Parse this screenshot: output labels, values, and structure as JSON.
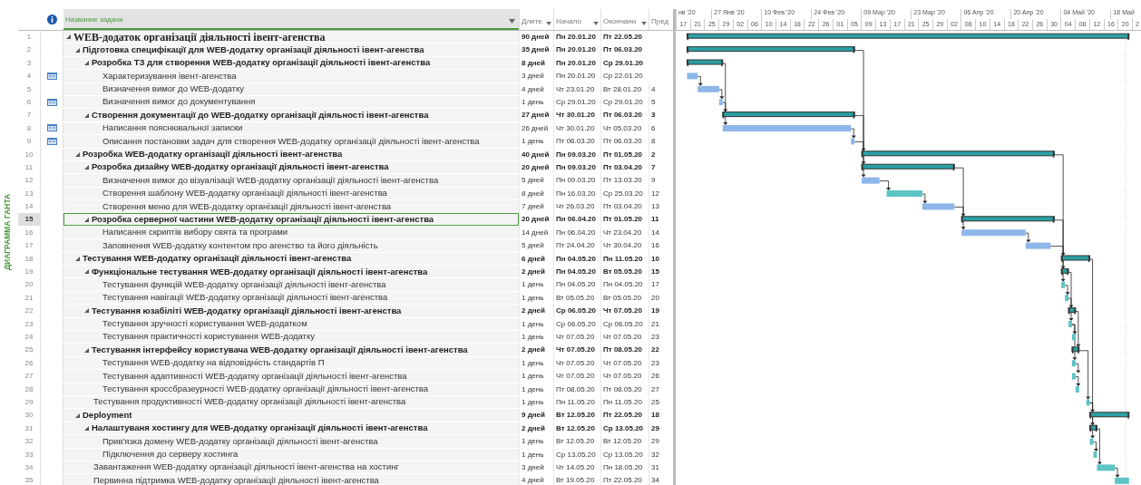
{
  "sidebar_label": "ДИАГРАММА ГАНТА",
  "columns": {
    "name": "Название задачи",
    "duration": "Длите",
    "start": "Начало",
    "finish": "Окончани",
    "predecessors": "Пред"
  },
  "timeline": {
    "weeks": [
      "нв '20",
      "27 Янв '20",
      "10 Фев '20",
      "24 Фев '20",
      "09 Мар '20",
      "23 Мар '20",
      "06 Апр '20",
      "20 Апр '20",
      "04 Май '20",
      "18 Май"
    ],
    "days": [
      "17",
      "21",
      "25",
      "29",
      "02",
      "06",
      "10",
      "14",
      "18",
      "22",
      "26",
      "01",
      "05",
      "09",
      "13",
      "17",
      "21",
      "25",
      "29",
      "02",
      "06",
      "10",
      "14",
      "18",
      "22",
      "26",
      "30",
      "04",
      "08",
      "12",
      "16",
      "20",
      "2"
    ]
  },
  "tasks": [
    {
      "id": "1",
      "kind": "summary",
      "expanded": true,
      "note": false,
      "selected": false,
      "name": "WEB-додаток організації діяльності івент-агенства",
      "duration": "90 дней",
      "start": "Пн 20.01.20",
      "finish": "Пт 22.05.20",
      "children": [
        {
          "id": "2",
          "kind": "summary",
          "expanded": true,
          "note": false,
          "selected": false,
          "name": "Підготовка специфікації для WEB-додатку організації діяльності івент-агенства",
          "duration": "35 дней",
          "start": "Пн 20.01.20",
          "finish": "Пт 06.03.20",
          "children": [
            {
              "id": "3",
              "kind": "summary",
              "expanded": true,
              "note": false,
              "selected": false,
              "name": "Розробка ТЗ для створення WEB-додатку організації діяльності івент-агенства",
              "duration": "8 дней",
              "start": "Пн 20.01.20",
              "finish": "Ср 29.01.20",
              "children": [
                {
                  "id": "4",
                  "kind": "task",
                  "critical": false,
                  "note": true,
                  "selected": false,
                  "name": "Характеризування івент-агенства",
                  "duration": "3 дней",
                  "start": "Пн 20.01.20",
                  "finish": "Ср 22.01.20"
                },
                {
                  "id": "5",
                  "kind": "task",
                  "critical": false,
                  "note": false,
                  "selected": false,
                  "name": "Визначення вимог до WEB-додатку",
                  "duration": "4 дней",
                  "start": "Чт 23.01.20",
                  "finish": "Вт 28.01.20",
                  "predecessors": "4"
                },
                {
                  "id": "6",
                  "kind": "task",
                  "critical": false,
                  "note": true,
                  "selected": false,
                  "name": "Визначення вимог до документування",
                  "duration": "1 день",
                  "start": "Ср 29.01.20",
                  "finish": "Ср 29.01.20",
                  "predecessors": "5"
                }
              ]
            },
            {
              "id": "7",
              "kind": "summary",
              "expanded": true,
              "note": false,
              "selected": false,
              "name": "Створення документації до WEB-додатку організації діяльності івент-агенства",
              "duration": "27 дней",
              "start": "Чт 30.01.20",
              "finish": "Пт 06.03.20",
              "predecessors": "3",
              "children": [
                {
                  "id": "8",
                  "kind": "task",
                  "critical": false,
                  "note": true,
                  "selected": false,
                  "name": "Написання пояснювальної записки",
                  "duration": "26 дней",
                  "start": "Чт 30.01.20",
                  "finish": "Чт 05.03.20",
                  "predecessors": "6"
                },
                {
                  "id": "9",
                  "kind": "task",
                  "critical": false,
                  "note": true,
                  "selected": false,
                  "name": "Описання постановки задач для створення WEB-додатку організації діяльності івент-агенства",
                  "duration": "1 день",
                  "start": "Пт 06.03.20",
                  "finish": "Пт 06.03.20",
                  "predecessors": "8"
                }
              ]
            }
          ]
        },
        {
          "id": "10",
          "kind": "summary",
          "expanded": true,
          "note": false,
          "selected": false,
          "name": "Розробка WEB-додатку організації діяльності івент-агенства",
          "duration": "40 дней",
          "start": "Пн 09.03.20",
          "finish": "Пт 01.05.20",
          "predecessors": "2",
          "children": [
            {
              "id": "11",
              "kind": "summary",
              "expanded": true,
              "note": false,
              "selected": false,
              "name": "Розробка дизайну  WEB-додатку організації діяльності івент-агенства",
              "duration": "20 дней",
              "start": "Пн 09.03.20",
              "finish": "Пт 03.04.20",
              "predecessors": "7",
              "children": [
                {
                  "id": "12",
                  "kind": "task",
                  "critical": false,
                  "note": false,
                  "selected": false,
                  "name": "Визначення вимог до візуалізації WEB-додатку організації діяльності івент-агенства",
                  "duration": "5 дней",
                  "start": "Пн 09.03.20",
                  "finish": "Пт 13.03.20",
                  "predecessors": "9"
                },
                {
                  "id": "13",
                  "kind": "task",
                  "critical": true,
                  "note": false,
                  "selected": false,
                  "name": "Створення шаблону WEB-додатку організації діяльності івент-агенства",
                  "duration": "8 дней",
                  "start": "Пн 16.03.20",
                  "finish": "Ср 25.03.20",
                  "predecessors": "12"
                },
                {
                  "id": "14",
                  "kind": "task",
                  "critical": false,
                  "note": false,
                  "selected": false,
                  "name": "Створення меню для WEB-додатку організації діяльності івент-агенства",
                  "duration": "7 дней",
                  "start": "Чт 26.03.20",
                  "finish": "Пт 03.04.20",
                  "predecessors": "13"
                }
              ]
            },
            {
              "id": "15",
              "kind": "summary",
              "expanded": true,
              "note": false,
              "selected": true,
              "name": "Розробка серверної частини WEB-додатку організації діяльності івент-агенства",
              "duration": "20 дней",
              "start": "Пн 06.04.20",
              "finish": "Пт 01.05.20",
              "predecessors": "11",
              "children": [
                {
                  "id": "16",
                  "kind": "task",
                  "critical": false,
                  "note": false,
                  "selected": false,
                  "name": "Написання скриптів вибору свята та програми",
                  "duration": "14 дней",
                  "start": "Пн 06.04.20",
                  "finish": "Чт 23.04.20",
                  "predecessors": "14"
                },
                {
                  "id": "17",
                  "kind": "task",
                  "critical": false,
                  "note": false,
                  "selected": false,
                  "name": "Заповнення WEB-додатку контентом про агенство та його діяльність",
                  "duration": "5 дней",
                  "start": "Пт 24.04.20",
                  "finish": "Чт 30.04.20",
                  "predecessors": "16"
                }
              ]
            }
          ]
        },
        {
          "id": "18",
          "kind": "summary",
          "expanded": true,
          "note": false,
          "selected": false,
          "name": "Тестування WEB-додатку організації діяльності івент-агенства",
          "duration": "6 дней",
          "start": "Пн 04.05.20",
          "finish": "Пн 11.05.20",
          "predecessors": "10",
          "children": [
            {
              "id": "19",
              "kind": "summary",
              "expanded": true,
              "note": false,
              "selected": false,
              "name": "Функціональне тестування WEB-додатку організації діяльності івент-агенства",
              "duration": "2 дней",
              "start": "Пн 04.05.20",
              "finish": "Вт 05.05.20",
              "predecessors": "15",
              "children": [
                {
                  "id": "20",
                  "kind": "task",
                  "critical": true,
                  "note": false,
                  "selected": false,
                  "name": "Тестування функцій WEB-додатку організації діяльності івент-агенства",
                  "duration": "1 день",
                  "start": "Пн 04.05.20",
                  "finish": "Пн 04.05.20",
                  "predecessors": "17"
                },
                {
                  "id": "21",
                  "kind": "task",
                  "critical": true,
                  "note": false,
                  "selected": false,
                  "name": "Тестування навігації WEB-додатку організації діяльності івент-агенства",
                  "duration": "1 день",
                  "start": "Вт 05.05.20",
                  "finish": "Вт 05.05.20",
                  "predecessors": "20"
                }
              ]
            },
            {
              "id": "22",
              "kind": "summary",
              "expanded": true,
              "note": false,
              "selected": false,
              "name": "Тестування юзабіліті WEB-додатку організації діяльності івент-агенства",
              "duration": "2 дней",
              "start": "Ср 06.05.20",
              "finish": "Чт 07.05.20",
              "predecessors": "19",
              "children": [
                {
                  "id": "23",
                  "kind": "task",
                  "critical": true,
                  "note": false,
                  "selected": false,
                  "name": "Тестування зручності користування WEB-додатком",
                  "duration": "1 день",
                  "start": "Ср 06.05.20",
                  "finish": "Ср 06.05.20",
                  "predecessors": "21"
                },
                {
                  "id": "24",
                  "kind": "task",
                  "critical": true,
                  "note": false,
                  "selected": false,
                  "name": "Тестування практичності користування WEB-додатку",
                  "duration": "1 день",
                  "start": "Чт 07.05.20",
                  "finish": "Чт 07.05.20",
                  "predecessors": "23"
                }
              ]
            },
            {
              "id": "25",
              "kind": "summary",
              "expanded": true,
              "note": false,
              "selected": false,
              "name": "Тестування інтерфейсу користувача WEB-додатку організації діяльності івент-агенства",
              "duration": "2 дней",
              "start": "Чт 07.05.20",
              "finish": "Пт 08.05.20",
              "predecessors": "22",
              "children": [
                {
                  "id": "26",
                  "kind": "task",
                  "critical": true,
                  "note": false,
                  "selected": false,
                  "name": "Тестування WEB-додатку на відповідність стандартів П",
                  "duration": "1 день",
                  "start": "Чт 07.05.20",
                  "finish": "Чт 07.05.20",
                  "predecessors": "23"
                },
                {
                  "id": "27",
                  "kind": "task",
                  "critical": true,
                  "note": false,
                  "selected": false,
                  "name": "Тестування адаптивності WEB-додатку організації діяльності івент-агенства",
                  "duration": "1 день",
                  "start": "Чт 07.05.20",
                  "finish": "Чт 07.05.20",
                  "predecessors": "26"
                },
                {
                  "id": "28",
                  "kind": "task",
                  "critical": true,
                  "note": false,
                  "selected": false,
                  "name": "Тестування кроссбразеурності WEB-додатку організації діяльності івент-агенства",
                  "duration": "1 день",
                  "start": "Пт 08.05.20",
                  "finish": "Пт 08.05.20",
                  "predecessors": "27"
                }
              ]
            },
            {
              "id": "29",
              "kind": "task",
              "critical": true,
              "note": false,
              "selected": false,
              "name": "Тестування продуктивності WEB-додатку організації діяльності івент-агенства",
              "duration": "1 день",
              "start": "Пн 11.05.20",
              "finish": "Пн 11.05.20",
              "predecessors": "25"
            }
          ]
        },
        {
          "id": "30",
          "kind": "summary",
          "expanded": true,
          "note": false,
          "selected": false,
          "name": "Deployment",
          "duration": "9 дней",
          "start": "Вт 12.05.20",
          "finish": "Пт 22.05.20",
          "predecessors": "18",
          "children": [
            {
              "id": "31",
              "kind": "summary",
              "expanded": true,
              "note": false,
              "selected": false,
              "name": "Налаштуваня хостингу для WEB-додатку організації діяльності івент-агенства",
              "duration": "2 дней",
              "start": "Вт 12.05.20",
              "finish": "Ср 13.05.20",
              "predecessors": "29",
              "children": [
                {
                  "id": "32",
                  "kind": "task",
                  "critical": true,
                  "note": false,
                  "selected": false,
                  "name": "Прив'язка домену WEB-додатку організації діяльності івент-агенства",
                  "duration": "1 день",
                  "start": "Вт 12.05.20",
                  "finish": "Вт 12.05.20",
                  "predecessors": "29"
                },
                {
                  "id": "33",
                  "kind": "task",
                  "critical": true,
                  "note": false,
                  "selected": false,
                  "name": "Підключення до серверу хостинга",
                  "duration": "1 день",
                  "start": "Ср 13.05.20",
                  "finish": "Ср 13.05.20",
                  "predecessors": "32"
                }
              ]
            },
            {
              "id": "34",
              "kind": "task",
              "critical": true,
              "note": false,
              "selected": false,
              "name": "Завантаження WEB-додатку організації діяльності івент-агенства на хостинг",
              "duration": "3 дней",
              "start": "Чт 14.05.20",
              "finish": "Пн 18.05.20",
              "predecessors": "31"
            },
            {
              "id": "35",
              "kind": "task",
              "critical": true,
              "note": false,
              "selected": false,
              "name": "Первинна підтримка WEB-додатку організації діяльності івент-агенства",
              "duration": "4 дней",
              "start": "Вт 19.05.20",
              "finish": "Пт 22.05.20",
              "predecessors": "34"
            }
          ]
        }
      ]
    }
  ]
}
